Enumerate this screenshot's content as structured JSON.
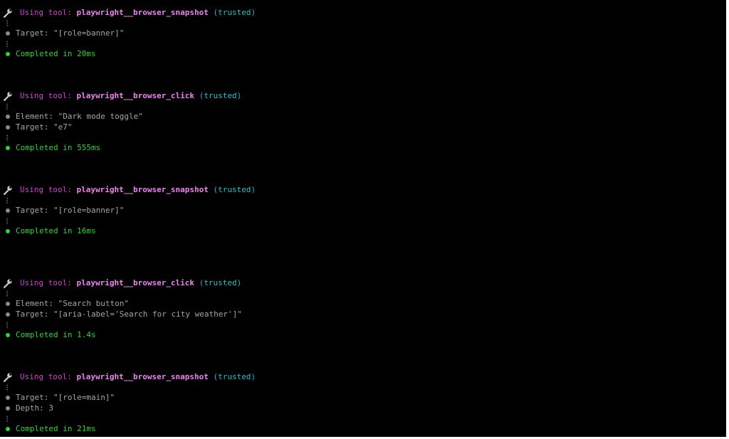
{
  "colors": {
    "background": "#000000",
    "using_label": "#d33fd3",
    "tool_name": "#f082f0",
    "trusted": "#29c3c3",
    "paren": "#3aa4e8",
    "param_text": "#a6a6a6",
    "completed": "#2fd42f"
  },
  "icons": {
    "tool": "wrench-icon",
    "param_bullet": "gray-dot",
    "done_bullet": "green-dot"
  },
  "common": {
    "using_label": "Using tool:",
    "open_paren": "(",
    "trusted": "trusted",
    "close_paren": ")"
  },
  "calls": [
    {
      "tool": "playwright__browser_snapshot",
      "params": [
        "Target: \"[role=banner]\""
      ],
      "completed": "Completed in 20ms"
    },
    {
      "tool": "playwright__browser_click",
      "params": [
        "Element: \"Dark mode toggle\"",
        "Target: \"e7\""
      ],
      "completed": "Completed in 555ms"
    },
    {
      "tool": "playwright__browser_snapshot",
      "params": [
        "Target: \"[role=banner]\""
      ],
      "completed": "Completed in 16ms"
    },
    {
      "tool": "playwright__browser_click",
      "params": [
        "Element: \"Search button\"",
        "Target: \"[aria-label='Search for city weather']\""
      ],
      "completed": "Completed in 1.4s"
    },
    {
      "tool": "playwright__browser_snapshot",
      "params": [
        "Target: \"[role=main]\"",
        "Depth: 3"
      ],
      "completed": "Completed in 21ms"
    }
  ]
}
